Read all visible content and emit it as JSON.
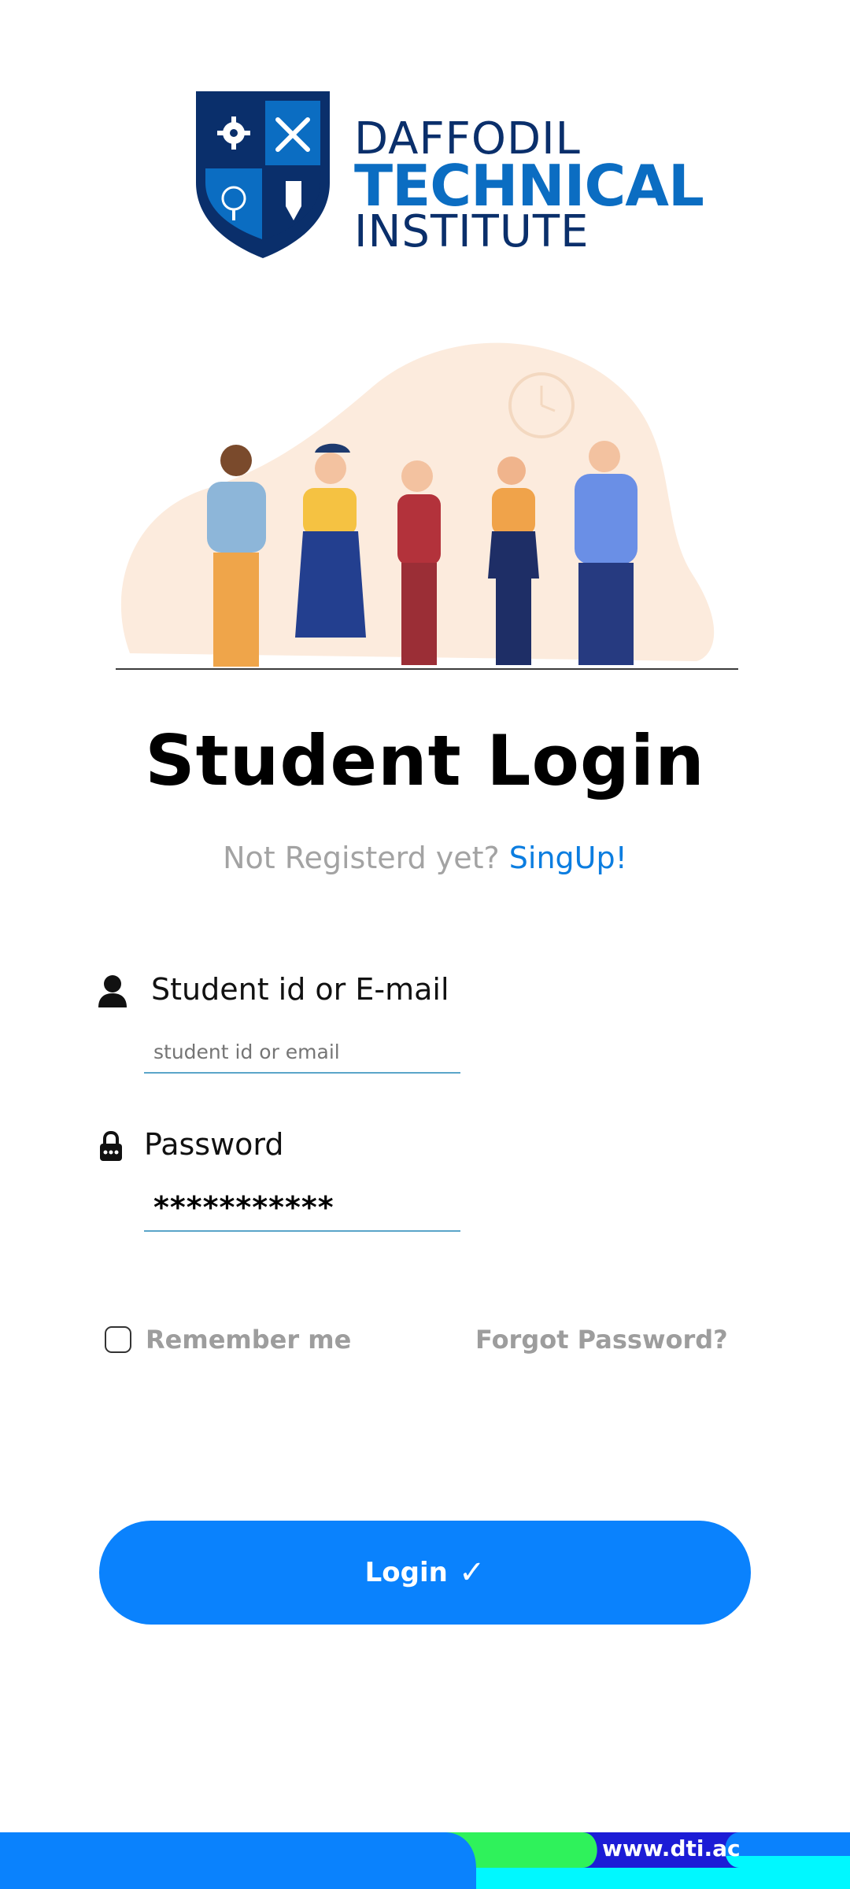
{
  "logo": {
    "line1": "DAFFODIL",
    "line2": "TECHNICAL",
    "line3": "INSTITUTE"
  },
  "title": "Student Login",
  "signup": {
    "question": "Not Registerd yet?",
    "link": "SingUp!"
  },
  "fields": {
    "student_id": {
      "label": "Student id or E-mail",
      "placeholder": "student id or email",
      "icon": "user-icon"
    },
    "password": {
      "label": "Password",
      "value": "***********",
      "icon": "lock-icon"
    }
  },
  "remember_label": "Remember me",
  "forgot_label": "Forgot Password?",
  "login": {
    "label": "Login",
    "icon": "check-icon",
    "glyph": "✓"
  },
  "footer": {
    "url": "www.dti.ac"
  },
  "colors": {
    "primary": "#0a82fd",
    "link": "#0b7de0",
    "logo_navy": "#0a2f6b",
    "logo_blue": "#0b6dc2",
    "muted": "#9d9d9d",
    "footer_green": "#2ff25b",
    "footer_cyan": "#00f8ff"
  }
}
